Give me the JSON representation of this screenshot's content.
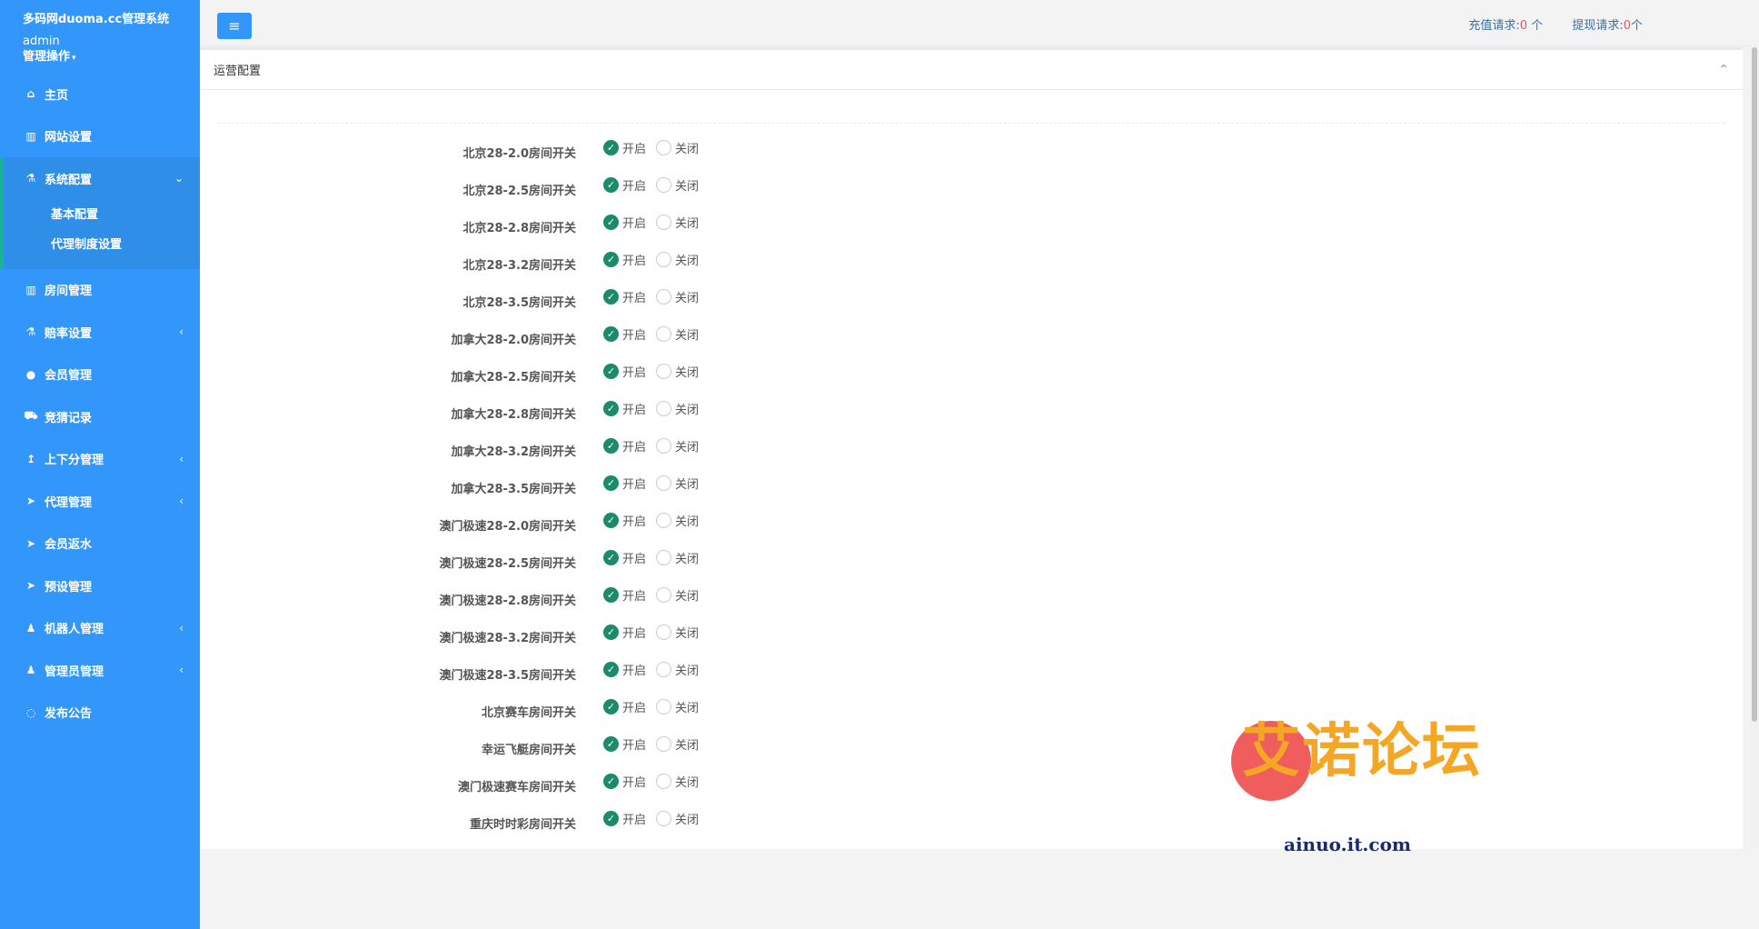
{
  "sidebar": {
    "app_title": "多码网duoma.cc管理系统",
    "user_name": "admin",
    "profile_menu": "管理操作",
    "items": [
      {
        "label": "主页",
        "icon": "home-icon",
        "glyph": "⌂",
        "arrow": ""
      },
      {
        "label": "网站设置",
        "icon": "columns-icon",
        "glyph": "▥",
        "arrow": ""
      },
      {
        "label": "系统配置",
        "icon": "flask-icon",
        "glyph": "⚗",
        "arrow": "⌄",
        "active": true,
        "children": [
          {
            "label": "基本配置"
          },
          {
            "label": "代理制度设置"
          }
        ]
      },
      {
        "label": "房间管理",
        "icon": "columns-icon",
        "glyph": "▥",
        "arrow": ""
      },
      {
        "label": "赔率设置",
        "icon": "flask-icon",
        "glyph": "⚗",
        "arrow": "‹"
      },
      {
        "label": "会员管理",
        "icon": "user-icon",
        "glyph": "●",
        "arrow": ""
      },
      {
        "label": "竞猜记录",
        "icon": "car-icon",
        "glyph": "⛟",
        "arrow": ""
      },
      {
        "label": "上下分管理",
        "icon": "upload-icon",
        "glyph": "↥",
        "arrow": "‹"
      },
      {
        "label": "代理管理",
        "icon": "paper-plane-icon",
        "glyph": "➤",
        "arrow": "‹"
      },
      {
        "label": "会员返水",
        "icon": "paper-plane-icon",
        "glyph": "➤",
        "arrow": ""
      },
      {
        "label": "预设管理",
        "icon": "paper-plane-icon",
        "glyph": "➤",
        "arrow": ""
      },
      {
        "label": "机器人管理",
        "icon": "male-icon",
        "glyph": "♟",
        "arrow": "‹"
      },
      {
        "label": "管理员管理",
        "icon": "male-icon",
        "glyph": "♟",
        "arrow": "‹"
      },
      {
        "label": "发布公告",
        "icon": "comment-icon",
        "glyph": "◌",
        "arrow": ""
      }
    ]
  },
  "topbar": {
    "menu_toggle_glyph": "≡",
    "recharge_label": "充值请求:",
    "recharge_count": "0",
    "recharge_unit": " 个",
    "withdraw_label": "提现请求:",
    "withdraw_count": "0",
    "withdraw_unit": "个"
  },
  "panel": {
    "title": "运营配置",
    "collapse_glyph": "⌃",
    "on_label": "开启",
    "off_label": "关闭",
    "rows": [
      {
        "label": "北京28-2.0房间开关",
        "value": "开启"
      },
      {
        "label": "北京28-2.5房间开关",
        "value": "开启"
      },
      {
        "label": "北京28-2.8房间开关",
        "value": "开启"
      },
      {
        "label": "北京28-3.2房间开关",
        "value": "开启"
      },
      {
        "label": "北京28-3.5房间开关",
        "value": "开启"
      },
      {
        "label": "加拿大28-2.0房间开关",
        "value": "开启"
      },
      {
        "label": "加拿大28-2.5房间开关",
        "value": "开启"
      },
      {
        "label": "加拿大28-2.8房间开关",
        "value": "开启"
      },
      {
        "label": "加拿大28-3.2房间开关",
        "value": "开启"
      },
      {
        "label": "加拿大28-3.5房间开关",
        "value": "开启"
      },
      {
        "label": "澳门极速28-2.0房间开关",
        "value": "开启"
      },
      {
        "label": "澳门极速28-2.5房间开关",
        "value": "开启"
      },
      {
        "label": "澳门极速28-2.8房间开关",
        "value": "开启"
      },
      {
        "label": "澳门极速28-3.2房间开关",
        "value": "开启"
      },
      {
        "label": "澳门极速28-3.5房间开关",
        "value": "开启"
      },
      {
        "label": "北京赛车房间开关",
        "value": "开启"
      },
      {
        "label": "幸运飞艇房间开关",
        "value": "开启"
      },
      {
        "label": "澳门极速赛车房间开关",
        "value": "开启"
      },
      {
        "label": "重庆时时彩房间开关",
        "value": "开启"
      }
    ]
  },
  "watermark": {
    "title": "艾诺论坛",
    "subtitle": "ainuo.it.com"
  },
  "colors": {
    "sidebar_bg": "#3296fa",
    "active_accent": "#1ab394",
    "radio_on": "#1c8b6c",
    "count_red": "#ed5565"
  }
}
